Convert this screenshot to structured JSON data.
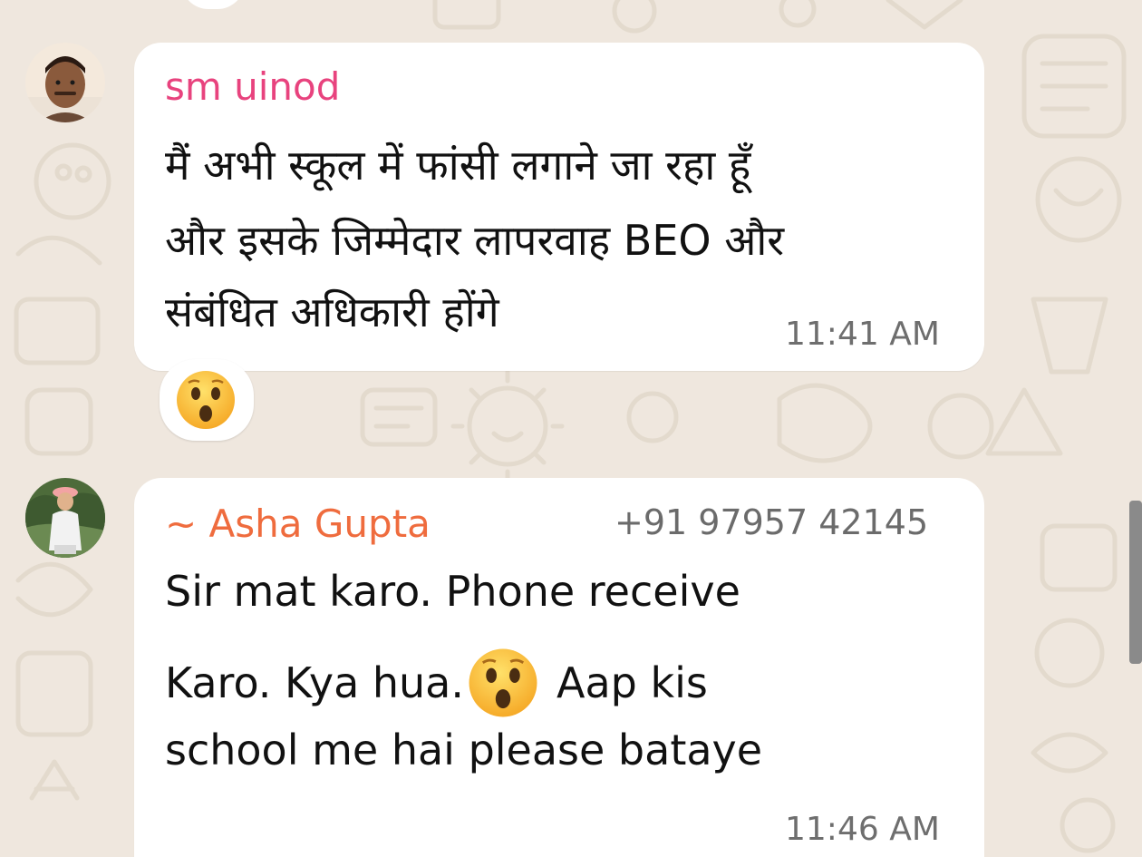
{
  "chat": {
    "messages": [
      {
        "sender": "sm uinod",
        "sender_color": "#e8437e",
        "lines": [
          "मैं अभी स्कूल में फांसी लगाने जा रहा हूँ",
          "और इसके जिम्मेदार लापरवाह BEO और",
          "संबंधित अधिकारी होंगे"
        ],
        "time": "11:41 AM",
        "reaction": "astonished-face-emoji"
      },
      {
        "sender": "~ Asha Gupta",
        "sender_color": "#ef6c3e",
        "phone": "+91 97957 42145",
        "line1": "Sir mat karo. Phone receive",
        "line2_before": "Karo. Kya hua.",
        "line2_emoji": "astonished-face-emoji",
        "line2_after": "Aap kis",
        "line3": "school me hai please bataye",
        "time": "11:46 AM"
      }
    ]
  },
  "colors": {
    "wallpaper": "#efe7de",
    "bubble": "#ffffff",
    "doodle": "#e2d9cd"
  }
}
